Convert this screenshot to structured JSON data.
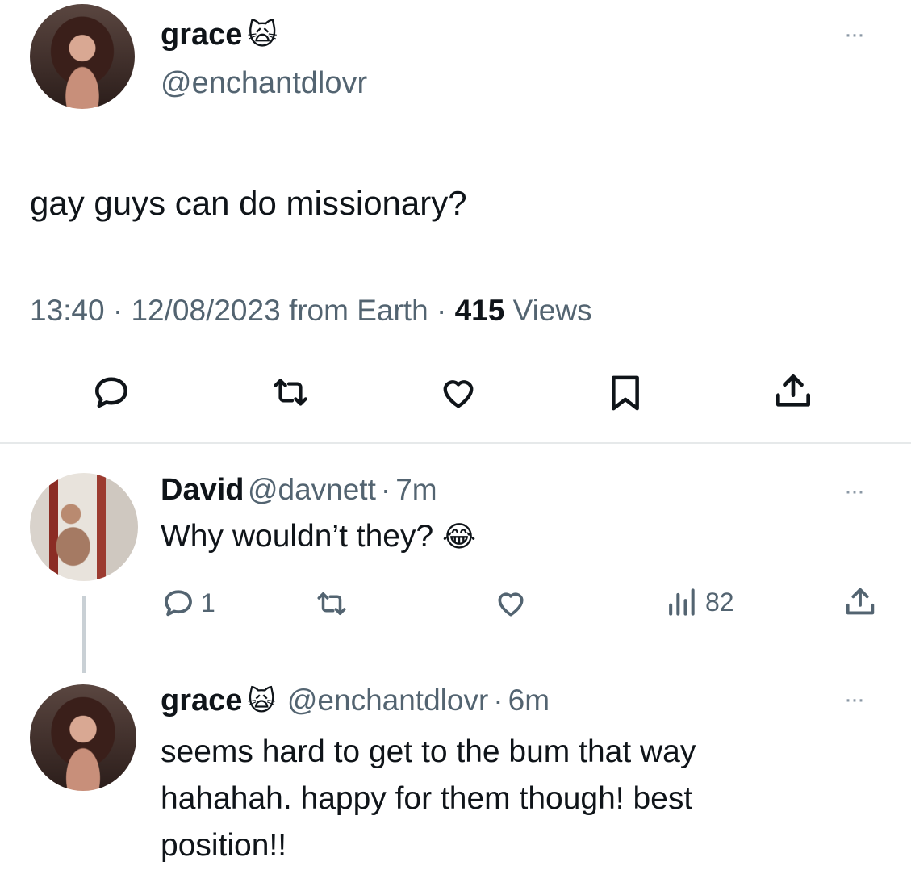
{
  "main_tweet": {
    "display_name": "grace",
    "name_emoji": "🙀",
    "handle": "@enchantdlovr",
    "text": "gay guys can do missionary?",
    "meta": {
      "time": "13:40",
      "date": "12/08/2023",
      "source": "from Earth",
      "views_count": "415",
      "views_label": "Views",
      "separator": "·"
    },
    "more_label": "···"
  },
  "replies": [
    {
      "display_name": "David",
      "handle": "@davnett",
      "separator": "·",
      "time": "7m",
      "text": "Why wouldn’t they?",
      "text_emoji": "😂",
      "reply_count": "1",
      "views_count": "82",
      "more_label": "···"
    },
    {
      "display_name": "grace",
      "name_emoji": "🙀",
      "handle": "@enchantdlovr",
      "separator": "·",
      "time": "6m",
      "text_lines": [
        "seems hard to get to the bum that way",
        "hahahah. happy for them though! best",
        "position!!"
      ],
      "more_label": "···"
    }
  ],
  "icons": [
    "reply-icon",
    "retweet-icon",
    "like-icon",
    "bookmark-icon",
    "share-icon",
    "views-icon"
  ],
  "colors": {
    "text": "#0f1419",
    "secondary": "#536471",
    "divider": "#e6e9ea"
  }
}
